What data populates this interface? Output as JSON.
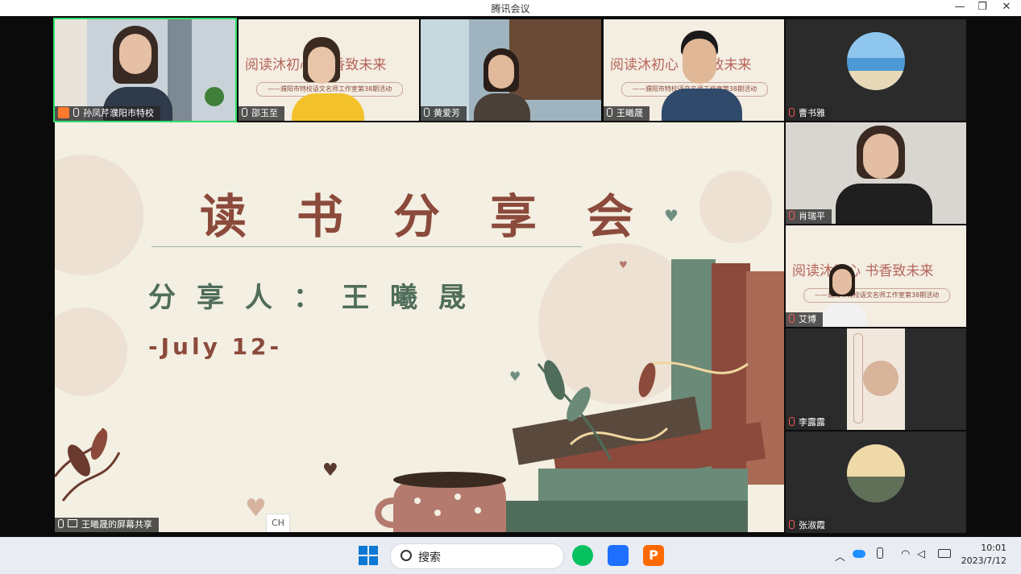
{
  "window": {
    "title": "腾讯会议",
    "minimize": "—",
    "restore": "❐",
    "close": "✕"
  },
  "top_participants": [
    {
      "name": "孙凤芹濮阳市特校",
      "host": true,
      "active": true
    },
    {
      "name": "邵玉至",
      "banner": "阅读沐初心 书香致未来",
      "sub": "——濮阳市特校语文名师工作室第38期活动"
    },
    {
      "name": "黄爱芳"
    },
    {
      "name": "王曦晟",
      "banner": "阅读沐初心 书香致未来",
      "sub": "——濮阳市特校语文名师工作室第38期活动"
    }
  ],
  "side_participants": [
    {
      "name": "曹书雅",
      "muted": true
    },
    {
      "name": "肖瑞平",
      "muted": true
    },
    {
      "name": "艾博",
      "muted": true,
      "banner": "阅读沐初心 书香致未来",
      "sub": "——濮阳市特校语文名师工作室第38期活动"
    },
    {
      "name": "李露露",
      "muted": true
    },
    {
      "name": "张淑霞",
      "muted": true
    }
  ],
  "share": {
    "label": "王曦晟的屏幕共享",
    "slide": {
      "title": "读书分享会",
      "sharer": "分享人：王曦晟",
      "date": "-July 12-"
    },
    "ime": "CH"
  },
  "taskbar": {
    "search_label": "搜索",
    "clock_time": "10:01",
    "clock_date": "2023/7/12",
    "colors": {
      "windows": "#0a78d4",
      "wechat": "#07c160",
      "meeting": "#1e6fff",
      "wps": "#ff6a00"
    }
  }
}
